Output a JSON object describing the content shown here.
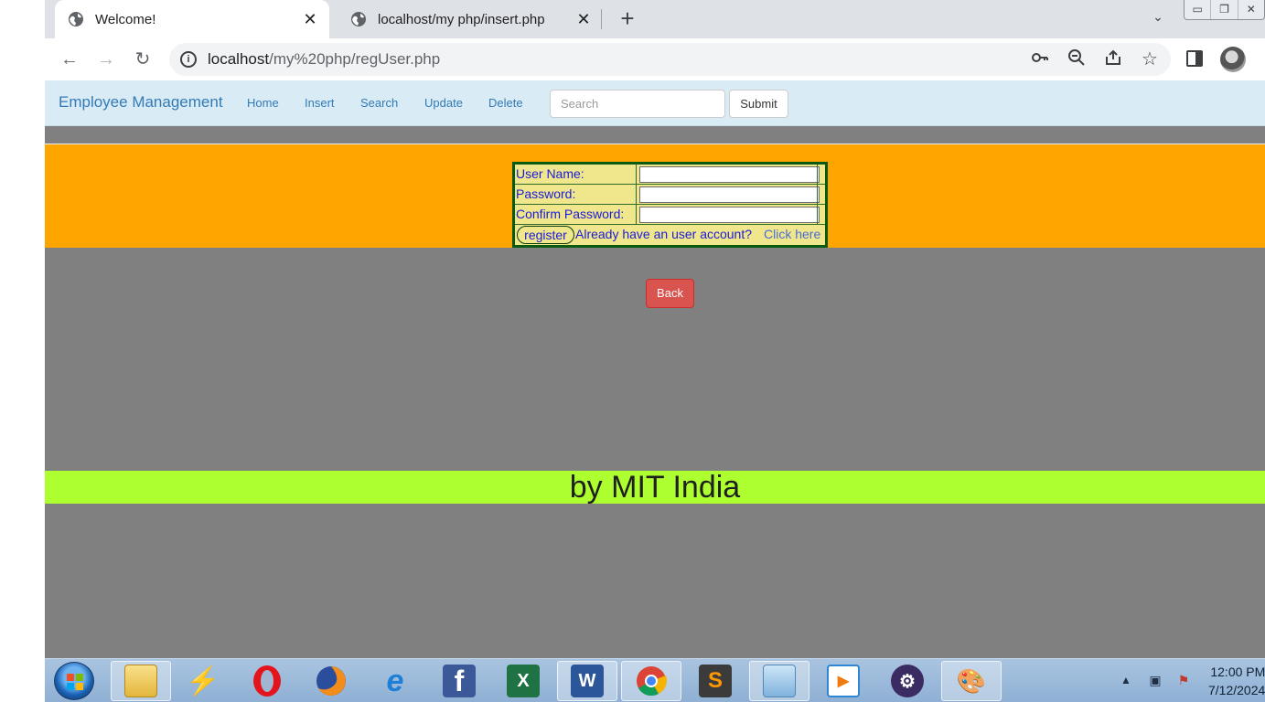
{
  "browser": {
    "tabs": [
      {
        "title": "Welcome!",
        "active": true
      },
      {
        "title": "localhost/my php/insert.php",
        "active": false
      }
    ],
    "url_host": "localhost",
    "url_path": "/my%20php/regUser.php",
    "icons": {
      "back": "arrow-left-icon",
      "forward": "arrow-right-icon",
      "reload": "reload-icon",
      "info": "info-icon",
      "key": "key-icon",
      "zoom": "zoom-out-icon",
      "share": "share-icon",
      "bookmark": "star-icon",
      "side_panel": "side-panel-icon",
      "profile": "profile-avatar"
    }
  },
  "navbar": {
    "brand": "Employee Management",
    "links": [
      "Home",
      "Insert",
      "Search",
      "Update",
      "Delete"
    ],
    "search_placeholder": "Search",
    "submit_label": "Submit"
  },
  "register_form": {
    "username_label": "User Name:",
    "password_label": "Password:",
    "confirm_label": "Confirm Password:",
    "register_label": "register",
    "already_text": "Already have an user account?",
    "click_here": "Click here"
  },
  "back_label": "Back",
  "footer_text": "by MIT India",
  "colors": {
    "orange_band": "#ffa500",
    "form_bg": "#f0e68c",
    "footer_bg": "#adff2f",
    "back_button": "#d9534f",
    "page_bg": "#808080"
  },
  "taskbar": {
    "apps": [
      "start-orb",
      "file-explorer-icon",
      "winamp-icon",
      "opera-icon",
      "firefox-icon",
      "internet-explorer-icon",
      "facebook-icon",
      "excel-icon",
      "word-icon",
      "chrome-icon",
      "sublime-text-icon",
      "notepad-icon",
      "media-player-icon",
      "settings-app-icon",
      "paint-icon"
    ],
    "time": "12:00 PM",
    "date": "7/12/2024"
  }
}
